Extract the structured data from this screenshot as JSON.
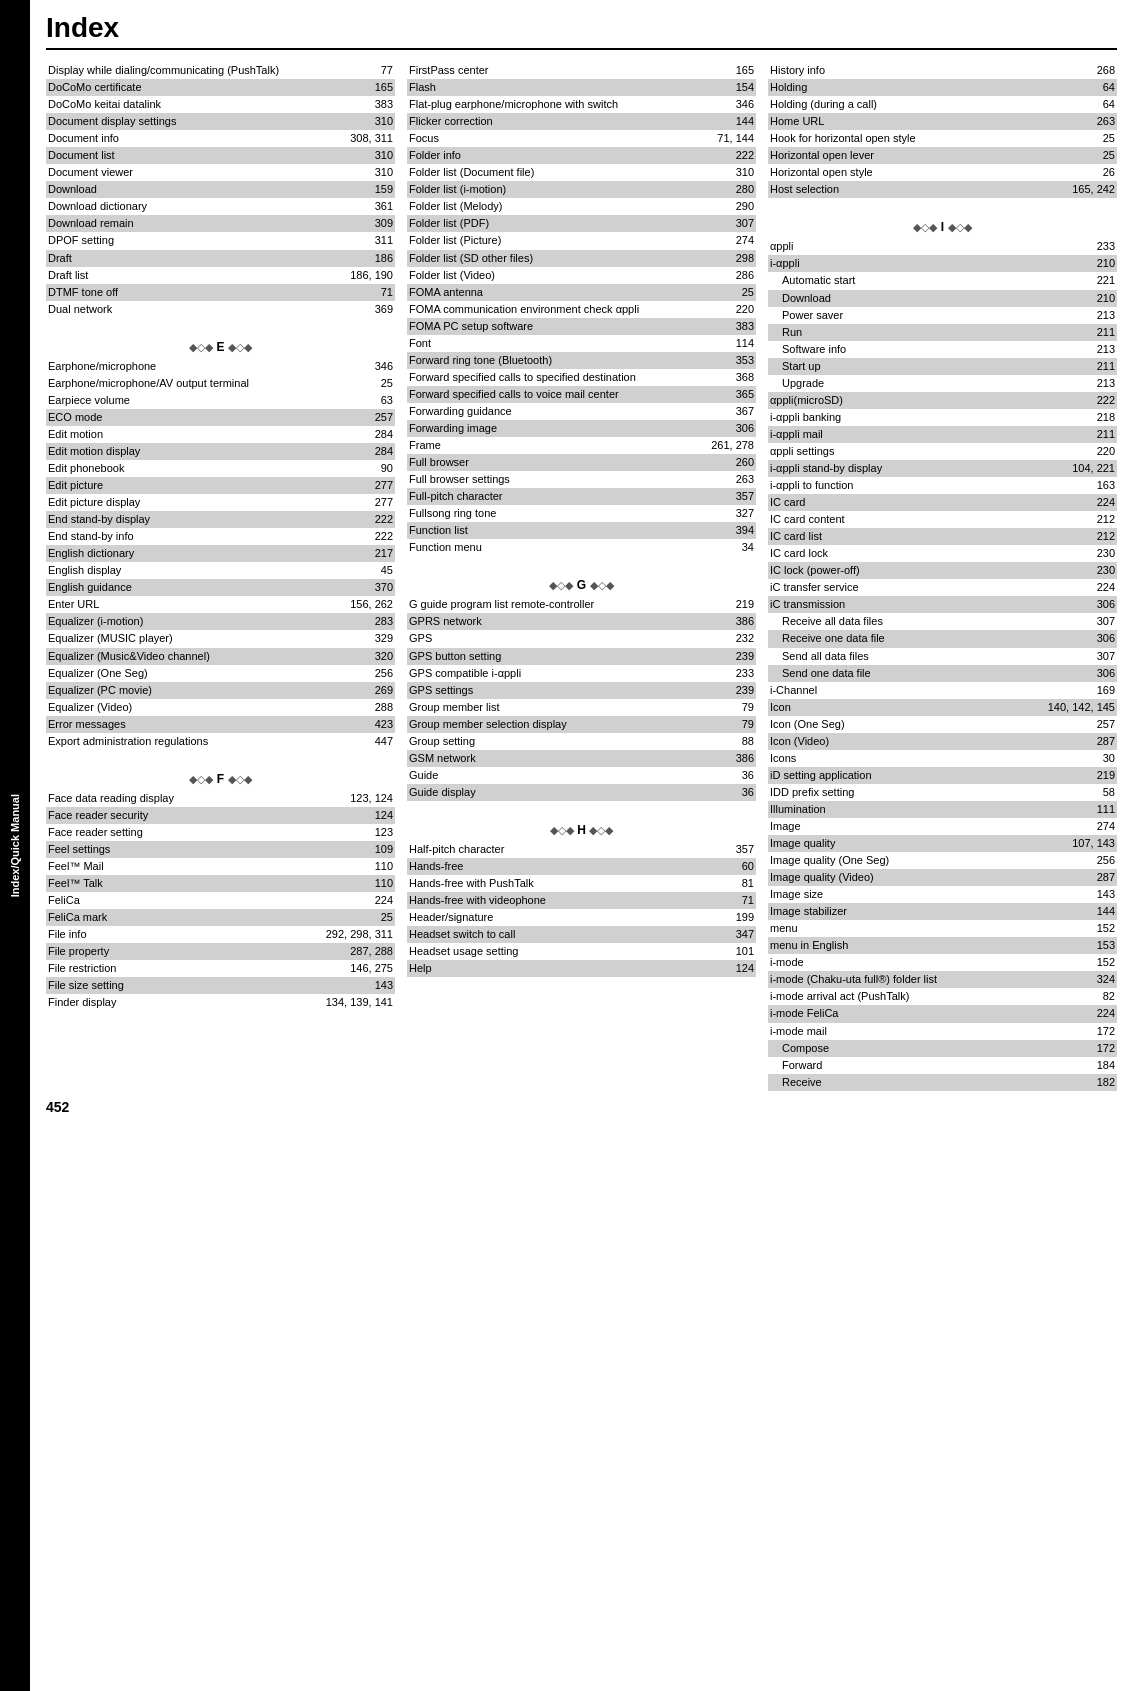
{
  "page": {
    "title": "Index",
    "page_number": "452",
    "sidebar_label": "Index/Quick Manual"
  },
  "columns": {
    "col1": {
      "entries": [
        {
          "name": "Display while dialing/communicating (PushTalk)",
          "page": "77",
          "shaded": false
        },
        {
          "name": "DoCoMo certificate",
          "page": "165",
          "shaded": true
        },
        {
          "name": "DoCoMo keitai datalink",
          "page": "383",
          "shaded": false
        },
        {
          "name": "Document display settings",
          "page": "310",
          "shaded": true
        },
        {
          "name": "Document info",
          "page": "308, 311",
          "shaded": false
        },
        {
          "name": "Document list",
          "page": "310",
          "shaded": true
        },
        {
          "name": "Document viewer",
          "page": "310",
          "shaded": false
        },
        {
          "name": "Download",
          "page": "159",
          "shaded": true
        },
        {
          "name": "Download dictionary",
          "page": "361",
          "shaded": false
        },
        {
          "name": "Download remain",
          "page": "309",
          "shaded": true
        },
        {
          "name": "DPOF setting",
          "page": "311",
          "shaded": false
        },
        {
          "name": "Draft",
          "page": "186",
          "shaded": true
        },
        {
          "name": "Draft list",
          "page": "186, 190",
          "shaded": false
        },
        {
          "name": "DTMF tone off",
          "page": "71",
          "shaded": true
        },
        {
          "name": "Dual network",
          "page": "369",
          "shaded": false
        }
      ],
      "section_e": {
        "header": "E",
        "entries": [
          {
            "name": "Earphone/microphone",
            "page": "346",
            "shaded": false
          },
          {
            "name": "Earphone/microphone/AV output terminal",
            "page": "25",
            "shaded": false,
            "wrapped": true
          },
          {
            "name": "Earpiece volume",
            "page": "63",
            "shaded": false
          },
          {
            "name": "ECO mode",
            "page": "257",
            "shaded": true
          },
          {
            "name": "Edit  motion",
            "page": "284",
            "shaded": false
          },
          {
            "name": "Edit  motion display",
            "page": "284",
            "shaded": true
          },
          {
            "name": "Edit phonebook",
            "page": "90",
            "shaded": false
          },
          {
            "name": "Edit picture",
            "page": "277",
            "shaded": true
          },
          {
            "name": "Edit picture display",
            "page": "277",
            "shaded": false
          },
          {
            "name": "End stand-by display",
            "page": "222",
            "shaded": true
          },
          {
            "name": "End stand-by info",
            "page": "222",
            "shaded": false
          },
          {
            "name": "English dictionary",
            "page": "217",
            "shaded": true
          },
          {
            "name": "English display",
            "page": "45",
            "shaded": false
          },
          {
            "name": "English guidance",
            "page": "370",
            "shaded": true
          },
          {
            "name": "Enter URL",
            "page": "156, 262",
            "shaded": false
          },
          {
            "name": "Equalizer (i-motion)",
            "page": "283",
            "shaded": true
          },
          {
            "name": "Equalizer (MUSIC player)",
            "page": "329",
            "shaded": false
          },
          {
            "name": "Equalizer (Music&Video channel)",
            "page": "320",
            "shaded": true
          },
          {
            "name": "Equalizer (One Seg)",
            "page": "256",
            "shaded": false
          },
          {
            "name": "Equalizer (PC movie)",
            "page": "269",
            "shaded": true
          },
          {
            "name": "Equalizer (Video)",
            "page": "288",
            "shaded": false
          },
          {
            "name": "Error messages",
            "page": "423",
            "shaded": true
          },
          {
            "name": "Export administration regulations",
            "page": "447",
            "shaded": false
          }
        ]
      },
      "section_f": {
        "header": "F",
        "entries": [
          {
            "name": "Face data reading display",
            "page": "123, 124",
            "shaded": false
          },
          {
            "name": "Face reader security",
            "page": "124",
            "shaded": true
          },
          {
            "name": "Face reader setting",
            "page": "123",
            "shaded": false
          },
          {
            "name": "Feel settings",
            "page": "109",
            "shaded": true
          },
          {
            "name": "Feel™ Mail",
            "page": "110",
            "shaded": false
          },
          {
            "name": "Feel™ Talk",
            "page": "110",
            "shaded": true
          },
          {
            "name": "FeliCa",
            "page": "224",
            "shaded": false
          },
          {
            "name": "FeliCa mark",
            "page": "25",
            "shaded": true
          },
          {
            "name": "File info",
            "page": "292, 298, 311",
            "shaded": false
          },
          {
            "name": "File property",
            "page": "287, 288",
            "shaded": true
          },
          {
            "name": "File restriction",
            "page": "146, 275",
            "shaded": false
          },
          {
            "name": "File size setting",
            "page": "143",
            "shaded": true
          },
          {
            "name": "Finder display",
            "page": "134, 139, 141",
            "shaded": false
          }
        ]
      }
    },
    "col2": {
      "entries": [
        {
          "name": "FirstPass center",
          "page": "165",
          "shaded": false
        },
        {
          "name": "Flash",
          "page": "154",
          "shaded": true
        },
        {
          "name": "Flat-plug earphone/microphone with switch",
          "page": "346",
          "shaded": false,
          "wrapped": true
        },
        {
          "name": "Flicker correction",
          "page": "144",
          "shaded": true
        },
        {
          "name": "Focus",
          "page": "71, 144",
          "shaded": false
        },
        {
          "name": "Folder info",
          "page": "222",
          "shaded": true
        },
        {
          "name": "Folder list (Document file)",
          "page": "310",
          "shaded": false
        },
        {
          "name": "Folder list (i-motion)",
          "page": "280",
          "shaded": true
        },
        {
          "name": "Folder list (Melody)",
          "page": "290",
          "shaded": false
        },
        {
          "name": "Folder list (PDF)",
          "page": "307",
          "shaded": true
        },
        {
          "name": "Folder list (Picture)",
          "page": "274",
          "shaded": false
        },
        {
          "name": "Folder list (SD other files)",
          "page": "298",
          "shaded": true
        },
        {
          "name": "Folder list (Video)",
          "page": "286",
          "shaded": false
        },
        {
          "name": "FOMA antenna",
          "page": "25",
          "shaded": true
        },
        {
          "name": "FOMA communication environment check αppli",
          "page": "220",
          "shaded": false,
          "wrapped": true
        },
        {
          "name": "FOMA PC setup software",
          "page": "383",
          "shaded": true
        },
        {
          "name": "Font",
          "page": "114",
          "shaded": false
        },
        {
          "name": "Forward ring tone (Bluetooth)",
          "page": "353",
          "shaded": true
        },
        {
          "name": "Forward specified calls to specified destination",
          "page": "368",
          "shaded": false,
          "wrapped": true
        },
        {
          "name": "Forward specified calls to voice mail center",
          "page": "365",
          "shaded": true,
          "wrapped": true
        },
        {
          "name": "Forwarding guidance",
          "page": "367",
          "shaded": false
        },
        {
          "name": "Forwarding image",
          "page": "306",
          "shaded": true
        },
        {
          "name": "Frame",
          "page": "261, 278",
          "shaded": false
        },
        {
          "name": "Full browser",
          "page": "260",
          "shaded": true
        },
        {
          "name": "Full browser settings",
          "page": "263",
          "shaded": false
        },
        {
          "name": "Full-pitch character",
          "page": "357",
          "shaded": true
        },
        {
          "name": "Fullsong ring tone",
          "page": "327",
          "shaded": false
        },
        {
          "name": "Function list",
          "page": "394",
          "shaded": true
        },
        {
          "name": "Function menu",
          "page": "34",
          "shaded": false
        }
      ],
      "section_g": {
        "header": "G",
        "entries": [
          {
            "name": "G guide program list remote-controller",
            "page": "219",
            "shaded": false
          },
          {
            "name": "GPRS network",
            "page": "386",
            "shaded": true
          },
          {
            "name": "GPS",
            "page": "232",
            "shaded": false
          },
          {
            "name": "GPS button setting",
            "page": "239",
            "shaded": true
          },
          {
            "name": "GPS compatible i-αppli",
            "page": "233",
            "shaded": false
          },
          {
            "name": "GPS settings",
            "page": "239",
            "shaded": true
          },
          {
            "name": "Group member list",
            "page": "79",
            "shaded": false
          },
          {
            "name": "Group member selection display",
            "page": "79",
            "shaded": true
          },
          {
            "name": "Group setting",
            "page": "88",
            "shaded": false
          },
          {
            "name": "GSM network",
            "page": "386",
            "shaded": true
          },
          {
            "name": "Guide",
            "page": "36",
            "shaded": false
          },
          {
            "name": "Guide display",
            "page": "36",
            "shaded": true
          }
        ]
      },
      "section_h": {
        "header": "H",
        "entries": [
          {
            "name": "Half-pitch character",
            "page": "357",
            "shaded": false
          },
          {
            "name": "Hands-free",
            "page": "60",
            "shaded": true
          },
          {
            "name": "Hands-free with PushTalk",
            "page": "81",
            "shaded": false
          },
          {
            "name": "Hands-free with videophone",
            "page": "71",
            "shaded": true
          },
          {
            "name": "Header/signature",
            "page": "199",
            "shaded": false
          },
          {
            "name": "Headset switch to call",
            "page": "347",
            "shaded": true
          },
          {
            "name": "Headset usage setting",
            "page": "101",
            "shaded": false
          },
          {
            "name": "Help",
            "page": "124",
            "shaded": true
          }
        ]
      }
    },
    "col3": {
      "entries": [
        {
          "name": "History info",
          "page": "268",
          "shaded": false
        },
        {
          "name": "Holding",
          "page": "64",
          "shaded": true
        },
        {
          "name": "Holding (during a call)",
          "page": "64",
          "shaded": false
        },
        {
          "name": "Home URL",
          "page": "263",
          "shaded": true
        },
        {
          "name": "Hook for horizontal open style",
          "page": "25",
          "shaded": false
        },
        {
          "name": "Horizontal open lever",
          "page": "25",
          "shaded": true
        },
        {
          "name": "Horizontal open style",
          "page": "26",
          "shaded": false
        },
        {
          "name": "Host selection",
          "page": "165, 242",
          "shaded": true
        }
      ],
      "section_i": {
        "header": "I",
        "entries": [
          {
            "name": "αppli",
            "page": "233",
            "shaded": false,
            "icon": true
          },
          {
            "name": "i-αppli",
            "page": "210",
            "shaded": true
          },
          {
            "name": "Automatic start",
            "page": "221",
            "shaded": false,
            "indent": true
          },
          {
            "name": "Download",
            "page": "210",
            "shaded": true,
            "indent": true
          },
          {
            "name": "Power saver",
            "page": "213",
            "shaded": false,
            "indent": true
          },
          {
            "name": "Run",
            "page": "211",
            "shaded": true,
            "indent": true
          },
          {
            "name": "Software info",
            "page": "213",
            "shaded": false,
            "indent": true
          },
          {
            "name": "Start up",
            "page": "211",
            "shaded": true,
            "indent": true
          },
          {
            "name": "Upgrade",
            "page": "213",
            "shaded": false,
            "indent": true
          },
          {
            "name": "αppli(microSD)",
            "page": "222",
            "shaded": true,
            "icon": true
          },
          {
            "name": "i-αppli banking",
            "page": "218",
            "shaded": false
          },
          {
            "name": "i-αppli mail",
            "page": "211",
            "shaded": true
          },
          {
            "name": "αppli settings",
            "page": "220",
            "shaded": false,
            "icon": true
          },
          {
            "name": "i-αppli stand-by display",
            "page": "104, 221",
            "shaded": true
          },
          {
            "name": "i-αppli to function",
            "page": "163",
            "shaded": false
          },
          {
            "name": "IC card",
            "page": "224",
            "shaded": true
          },
          {
            "name": "IC card content",
            "page": "212",
            "shaded": false
          },
          {
            "name": "IC card list",
            "page": "212",
            "shaded": true
          },
          {
            "name": "IC card lock",
            "page": "230",
            "shaded": false
          },
          {
            "name": "IC lock (power-off)",
            "page": "230",
            "shaded": true
          },
          {
            "name": "iC transfer service",
            "page": "224",
            "shaded": false
          },
          {
            "name": "iC transmission",
            "page": "306",
            "shaded": true
          },
          {
            "name": "Receive all data files",
            "page": "307",
            "shaded": false,
            "indent": true
          },
          {
            "name": "Receive one data file",
            "page": "306",
            "shaded": true,
            "indent": true
          },
          {
            "name": "Send all data files",
            "page": "307",
            "shaded": false,
            "indent": true
          },
          {
            "name": "Send one data file",
            "page": "306",
            "shaded": true,
            "indent": true
          },
          {
            "name": "i-Channel",
            "page": "169",
            "shaded": false
          },
          {
            "name": "Icon",
            "page": "140, 142, 145",
            "shaded": true
          },
          {
            "name": "Icon (One Seg)",
            "page": "257",
            "shaded": false
          },
          {
            "name": "Icon (Video)",
            "page": "287",
            "shaded": true
          },
          {
            "name": "Icons",
            "page": "30",
            "shaded": false
          },
          {
            "name": "iD setting application",
            "page": "219",
            "shaded": true
          },
          {
            "name": "IDD prefix setting",
            "page": "58",
            "shaded": false
          },
          {
            "name": "Illumination",
            "page": "111",
            "shaded": true
          },
          {
            "name": "Image",
            "page": "274",
            "shaded": false
          },
          {
            "name": "Image quality",
            "page": "107, 143",
            "shaded": true
          },
          {
            "name": "Image quality (One Seg)",
            "page": "256",
            "shaded": false
          },
          {
            "name": "Image quality (Video)",
            "page": "287",
            "shaded": true
          },
          {
            "name": "Image size",
            "page": "143",
            "shaded": false
          },
          {
            "name": "Image stabilizer",
            "page": "144",
            "shaded": true
          },
          {
            "name": "menu",
            "page": "152",
            "shaded": false,
            "icon": true
          },
          {
            "name": "menu in English",
            "page": "153",
            "shaded": true,
            "icon": true
          },
          {
            "name": "i-mode",
            "page": "152",
            "shaded": false
          },
          {
            "name": "i-mode (Chaku-uta full®) folder list",
            "page": "324",
            "shaded": true
          },
          {
            "name": "i-mode arrival act (PushTalk)",
            "page": "82",
            "shaded": false
          },
          {
            "name": "i-mode FeliCa",
            "page": "224",
            "shaded": true
          },
          {
            "name": "i-mode mail",
            "page": "172",
            "shaded": false
          },
          {
            "name": "Compose",
            "page": "172",
            "shaded": true,
            "indent": true
          },
          {
            "name": "Forward",
            "page": "184",
            "shaded": false,
            "indent": true
          },
          {
            "name": "Receive",
            "page": "182",
            "shaded": true,
            "indent": true
          }
        ]
      }
    }
  }
}
